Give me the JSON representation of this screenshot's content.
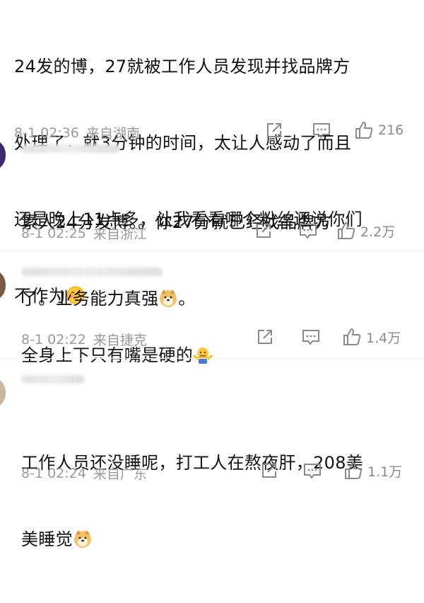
{
  "comments": [
    {
      "text_lines": [
        "24发的博，27就被工作人员发现并找品牌方",
        "处理了，就3分钟的时间，太让人感动了而且",
        "还是晚上11点多，让我看看哪个粉丝还说你们",
        "不作为"
      ],
      "emoji": "blush-emoji",
      "time": "8-1 02:36",
      "location": "来自湖南",
      "likes": "216"
    },
    {
      "text_lines": [
        "素人24分发博。。你27分就已经找品牌方",
        "了。业务能力真强"
      ],
      "emoji_suffix": "。",
      "emoji": "doge-emoji",
      "time": "8-1 02:25",
      "location": "来自浙江",
      "likes": "2.2万"
    },
    {
      "text_lines": [
        "全身上下只有嘴是硬的"
      ],
      "emoji": "shrug-emoji",
      "time": "8-1 02:22",
      "location": "来自捷克",
      "likes": "1.4万"
    },
    {
      "text_lines": [
        "工作人员还没睡呢，打工人在熬夜肝，208美",
        "美睡觉"
      ],
      "emoji": "doge-emoji",
      "time": "8-1 02:24",
      "location": "来自广东",
      "likes": "1.1万"
    }
  ],
  "colors": {
    "text": "#111111",
    "meta": "#9a9a9a",
    "icon": "#8a8a8a"
  },
  "icons": [
    "share-icon",
    "comment-icon",
    "like-icon"
  ]
}
